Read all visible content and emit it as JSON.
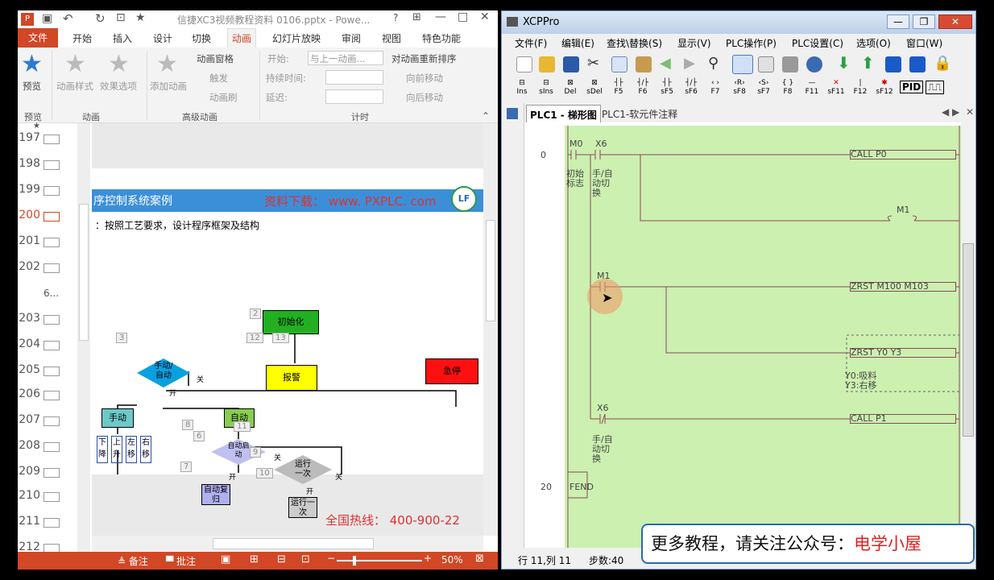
{
  "ppt": {
    "title": "信捷XC3视频教程资料 0106.pptx - Powe...",
    "file_tab": "文件",
    "tabs": [
      "开始",
      "插入",
      "设计",
      "切换",
      "动画",
      "幻灯片放映",
      "审阅",
      "视图",
      "特色功能"
    ],
    "ribbon": {
      "preview": "预览",
      "anim_style": "动画样式",
      "effect_options": "效果选项",
      "add_anim": "添加动画",
      "anim_pane": "动画窗格",
      "trigger": "触发",
      "anim_brush": "动画刷",
      "start_label": "开始:",
      "start_value": "与上一动画...",
      "duration_label": "持续时间:",
      "delay_label": "延迟:",
      "reorder_title": "对动画重新排序",
      "move_earlier": "向前移动",
      "move_later": "向后移动",
      "groups": {
        "preview": "预览",
        "animation": "动画",
        "advanced": "高级动画",
        "timing": "计时"
      }
    },
    "slides": [
      "197",
      "198",
      "199",
      "200",
      "201",
      "202",
      "6...",
      "203",
      "204",
      "205",
      "206",
      "207",
      "208",
      "209",
      "210",
      "211",
      "212"
    ],
    "slide": {
      "header": "序控制系统案例",
      "download": "资料下载： www. PXPLC. com",
      "subtitle": "：按照工艺要求，设计程序框架及结构",
      "init": "初始化",
      "alarm": "报警",
      "estop": "急停",
      "manual_auto": "手动/自动",
      "manual": "手动",
      "auto": "自动",
      "auto_start": "自动启动",
      "run_once": "运行一次",
      "run_once2": "运行一次",
      "auto_reset": "自动复归",
      "off": "关",
      "on": "开",
      "down": "下降",
      "up": "上升",
      "left": "左移",
      "right": "右移",
      "hotline": "全国热线： 400-900-22",
      "nums": [
        "2",
        "3",
        "12",
        "13",
        "8",
        "6",
        "11",
        "9",
        "7",
        "10"
      ]
    },
    "status": {
      "notes": "备注",
      "comments": "批注",
      "zoom": "50%"
    }
  },
  "xcp": {
    "title": "XCPPro",
    "menu": [
      "文件(F)",
      "编辑(E)",
      "查找\\替换(S)",
      "显示(V)",
      "PLC操作(P)",
      "PLC设置(C)",
      "选项(O)",
      "窗口(W)"
    ],
    "ladder_symbols": [
      [
        "Ins"
      ],
      [
        "sIns"
      ],
      [
        "Del"
      ],
      [
        "sDel"
      ],
      [
        "F5"
      ],
      [
        "F6"
      ],
      [
        "sF5"
      ],
      [
        "sF6"
      ],
      [
        "F7"
      ],
      [
        "sF8"
      ],
      [
        "sF7"
      ],
      [
        "F8"
      ],
      [
        "F11"
      ],
      [
        "sF11"
      ],
      [
        "F12"
      ],
      [
        "sF12"
      ]
    ],
    "tabs": [
      "PLC1 - 梯形图",
      "PLC1-软元件注释"
    ],
    "ladder": {
      "step0": "0",
      "step20": "20",
      "m0": "M0",
      "x6": "X6",
      "m0_comment": "初始标志",
      "x6_comment": "手/自动切换",
      "call_p0": "CALL     P0",
      "m1_coil": "M1",
      "m1_contact": "M1",
      "zrst1": "ZRST    M100    M103",
      "zrst2": "ZRST     Y0       Y3",
      "y0_note": "Y0:吸料",
      "y3_note": "Y3:右移",
      "x6b": "X6",
      "x6b_comment": "手/自动切换",
      "call_p1": "CALL     P1",
      "fend": "FEND"
    },
    "status": {
      "pos": "行 11,列 11",
      "steps": "步数:40"
    }
  },
  "banner": {
    "prefix": "更多教程，请关注公众号：",
    "name": "电学小屋"
  }
}
